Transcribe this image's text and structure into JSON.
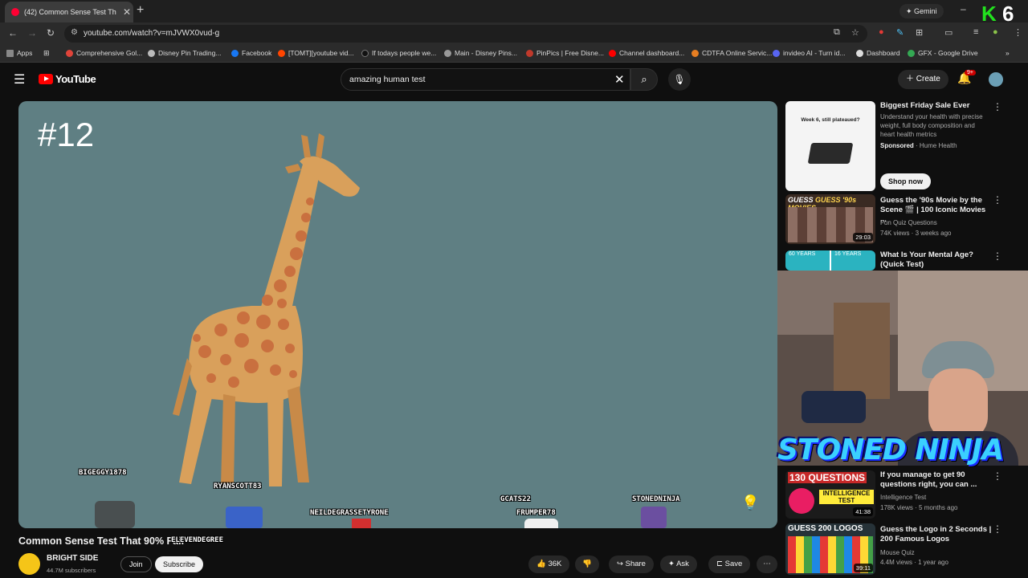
{
  "browser": {
    "tab_title": "(42) Common Sense Test Th",
    "url": "youtube.com/watch?v=mJVWX0vud-g",
    "gemini_label": "Gemini",
    "bookmarks": [
      {
        "label": "Apps",
        "color": "#888888"
      },
      {
        "label": "Comprehensive Gol...",
        "color": "#e0443a"
      },
      {
        "label": "Disney Pin Trading...",
        "color": "#bbbbbb"
      },
      {
        "label": "Facebook",
        "color": "#1877f2"
      },
      {
        "label": "[TOMT][youtube vid...",
        "color": "#ff4500"
      },
      {
        "label": "If todays people we...",
        "color": "#111111"
      },
      {
        "label": "Main - Disney Pins...",
        "color": "#999999"
      },
      {
        "label": "PinPics | Free Disne...",
        "color": "#c0392b"
      },
      {
        "label": "Channel dashboard...",
        "color": "#ff0000"
      },
      {
        "label": "CDTFA Online Servic...",
        "color": "#e67e22"
      },
      {
        "label": "invideo AI - Turn id...",
        "color": "#5865f2"
      },
      {
        "label": "Dashboard",
        "color": "#dddddd"
      },
      {
        "label": "GFX - Google Drive",
        "color": "#34a853"
      }
    ]
  },
  "youtube": {
    "logo_text": "YouTube",
    "search_value": "amazing human test",
    "create_label": "Create",
    "notif_badge": "9+"
  },
  "video": {
    "number_text": "#12",
    "usernames": [
      "BIGEGGY1878",
      "RYANSCOTT83",
      "NEILDEGRASSETYRONE",
      "GCATS22",
      "FRUMPER78",
      "STONEDNINJA",
      "ELEVENDEGREE"
    ],
    "title": "Common Sense Test That 90% Fail",
    "channel": "BRIGHT SIDE",
    "subscribers": "44.7M subscribers",
    "join_label": "Join",
    "subscribe_label": "Subscribe",
    "like_count": "36K",
    "share_label": "Share",
    "ask_label": "Ask",
    "save_label": "Save"
  },
  "sidebar": {
    "recs": [
      {
        "title": "Biggest Friday Sale Ever",
        "desc": "Understand your health with precise weight, full body composition and heart health metrics",
        "sponsored": "Sponsored",
        "advertiser": "Hume Health",
        "cta": "Shop now",
        "thumb_title": "Week 6, still plateaued?"
      },
      {
        "title": "Guess the '90s Movie by the Scene 🎬 | 100 Iconic Movies ...",
        "channel": "Fun Quiz Questions",
        "meta": "74K views · 3 weeks ago",
        "duration": "29:03",
        "thumb_text": "GUESS '90s MOVIES"
      },
      {
        "title": "What Is Your Mental Age? (Quick Test)",
        "thumb_left": "60 YEARS",
        "thumb_right": "16 YEARS"
      },
      {
        "title": "If you manage to get 90 questions right, you can ...",
        "channel": "Intelligence Test",
        "meta": "178K views · 5 months ago",
        "duration": "41:38",
        "thumb_text": "130 QUESTIONS",
        "thumb_sub": "INTELLIGENCE TEST"
      },
      {
        "title": "Guess the Logo in 2 Seconds | 200 Famous Logos",
        "channel": "Mouse Quiz",
        "meta": "4.4M views · 1 year ago",
        "duration": "39:11",
        "thumb_text": "GUESS 200 LOGOS"
      }
    ]
  },
  "overlay": {
    "stream_name": "STONED NINJA",
    "stream_badge": "K6"
  },
  "colors": {
    "yt_red": "#ff0000",
    "video_bg": "#5f7f83",
    "giraffe": "#d9a05b",
    "spots": "#c9703f"
  }
}
